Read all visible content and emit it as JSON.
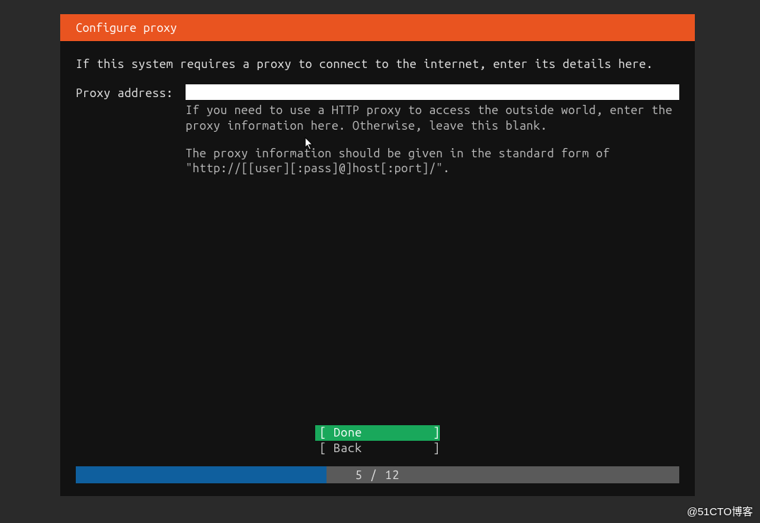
{
  "header": {
    "title": "Configure proxy"
  },
  "intro": "If this system requires a proxy to connect to the internet, enter its details here.",
  "form": {
    "proxy_label": "Proxy address:",
    "proxy_value": "",
    "help_line1": "If you need to use a HTTP proxy to access the outside world, enter the proxy information here. Otherwise, leave this blank.",
    "help_line2": "The proxy information should be given in the standard form of \"http://[[user][:pass]@]host[:port]/\"."
  },
  "buttons": {
    "done": "[ Done          ]",
    "back": "[ Back          ]"
  },
  "progress": {
    "current": 5,
    "total": 12,
    "label": "5 / 12",
    "percent": 41.6
  },
  "watermark": "@51CTO博客",
  "colors": {
    "accent": "#e95420",
    "selected": "#19a85b",
    "progress_fill": "#0f5f9e",
    "progress_bg": "#5a5a5a",
    "bg": "#121212"
  }
}
